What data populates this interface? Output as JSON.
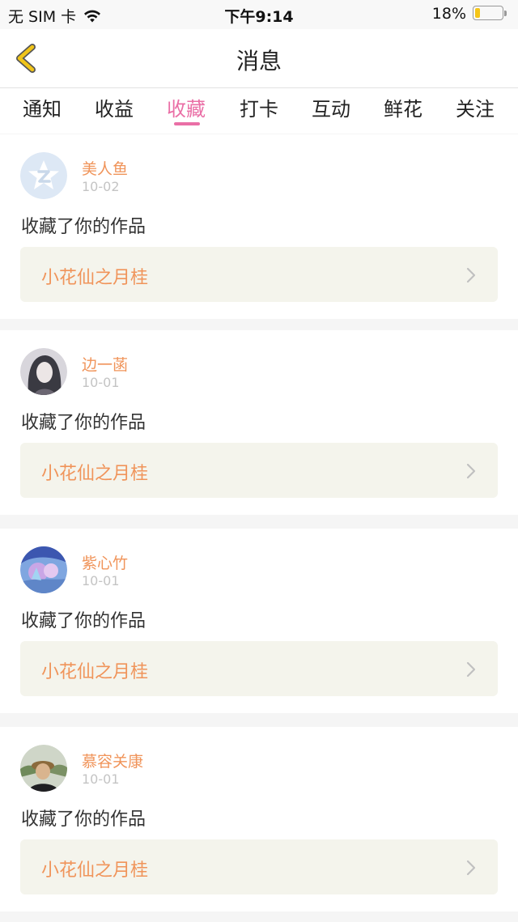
{
  "status_bar": {
    "carrier": "无 SIM 卡",
    "time": "下午9:14",
    "battery_percent": "18%",
    "battery_level": 0.18,
    "battery_color": "#f5c518"
  },
  "nav": {
    "title": "消息",
    "back_icon": "chevron-left-icon",
    "back_color": "#f0c419"
  },
  "tabs": [
    {
      "label": "通知"
    },
    {
      "label": "收益"
    },
    {
      "label": "收藏",
      "active": true
    },
    {
      "label": "打卡"
    },
    {
      "label": "互动"
    },
    {
      "label": "鲜花"
    },
    {
      "label": "关注"
    }
  ],
  "accent_color": "#ea6fa6",
  "name_color": "#f0945a",
  "messages": [
    {
      "user_name": "美人鱼",
      "date": "10-02",
      "action": "收藏了你的作品",
      "work_title": "小花仙之月桂",
      "avatar": "default-star-avatar"
    },
    {
      "user_name": "边一菡",
      "date": "10-01",
      "action": "收藏了你的作品",
      "work_title": "小花仙之月桂",
      "avatar": "photo-avatar"
    },
    {
      "user_name": "紫心竹",
      "date": "10-01",
      "action": "收藏了你的作品",
      "work_title": "小花仙之月桂",
      "avatar": "photo-avatar"
    },
    {
      "user_name": "慕容关康",
      "date": "10-01",
      "action": "收藏了你的作品",
      "work_title": "小花仙之月桂",
      "avatar": "photo-avatar"
    }
  ]
}
